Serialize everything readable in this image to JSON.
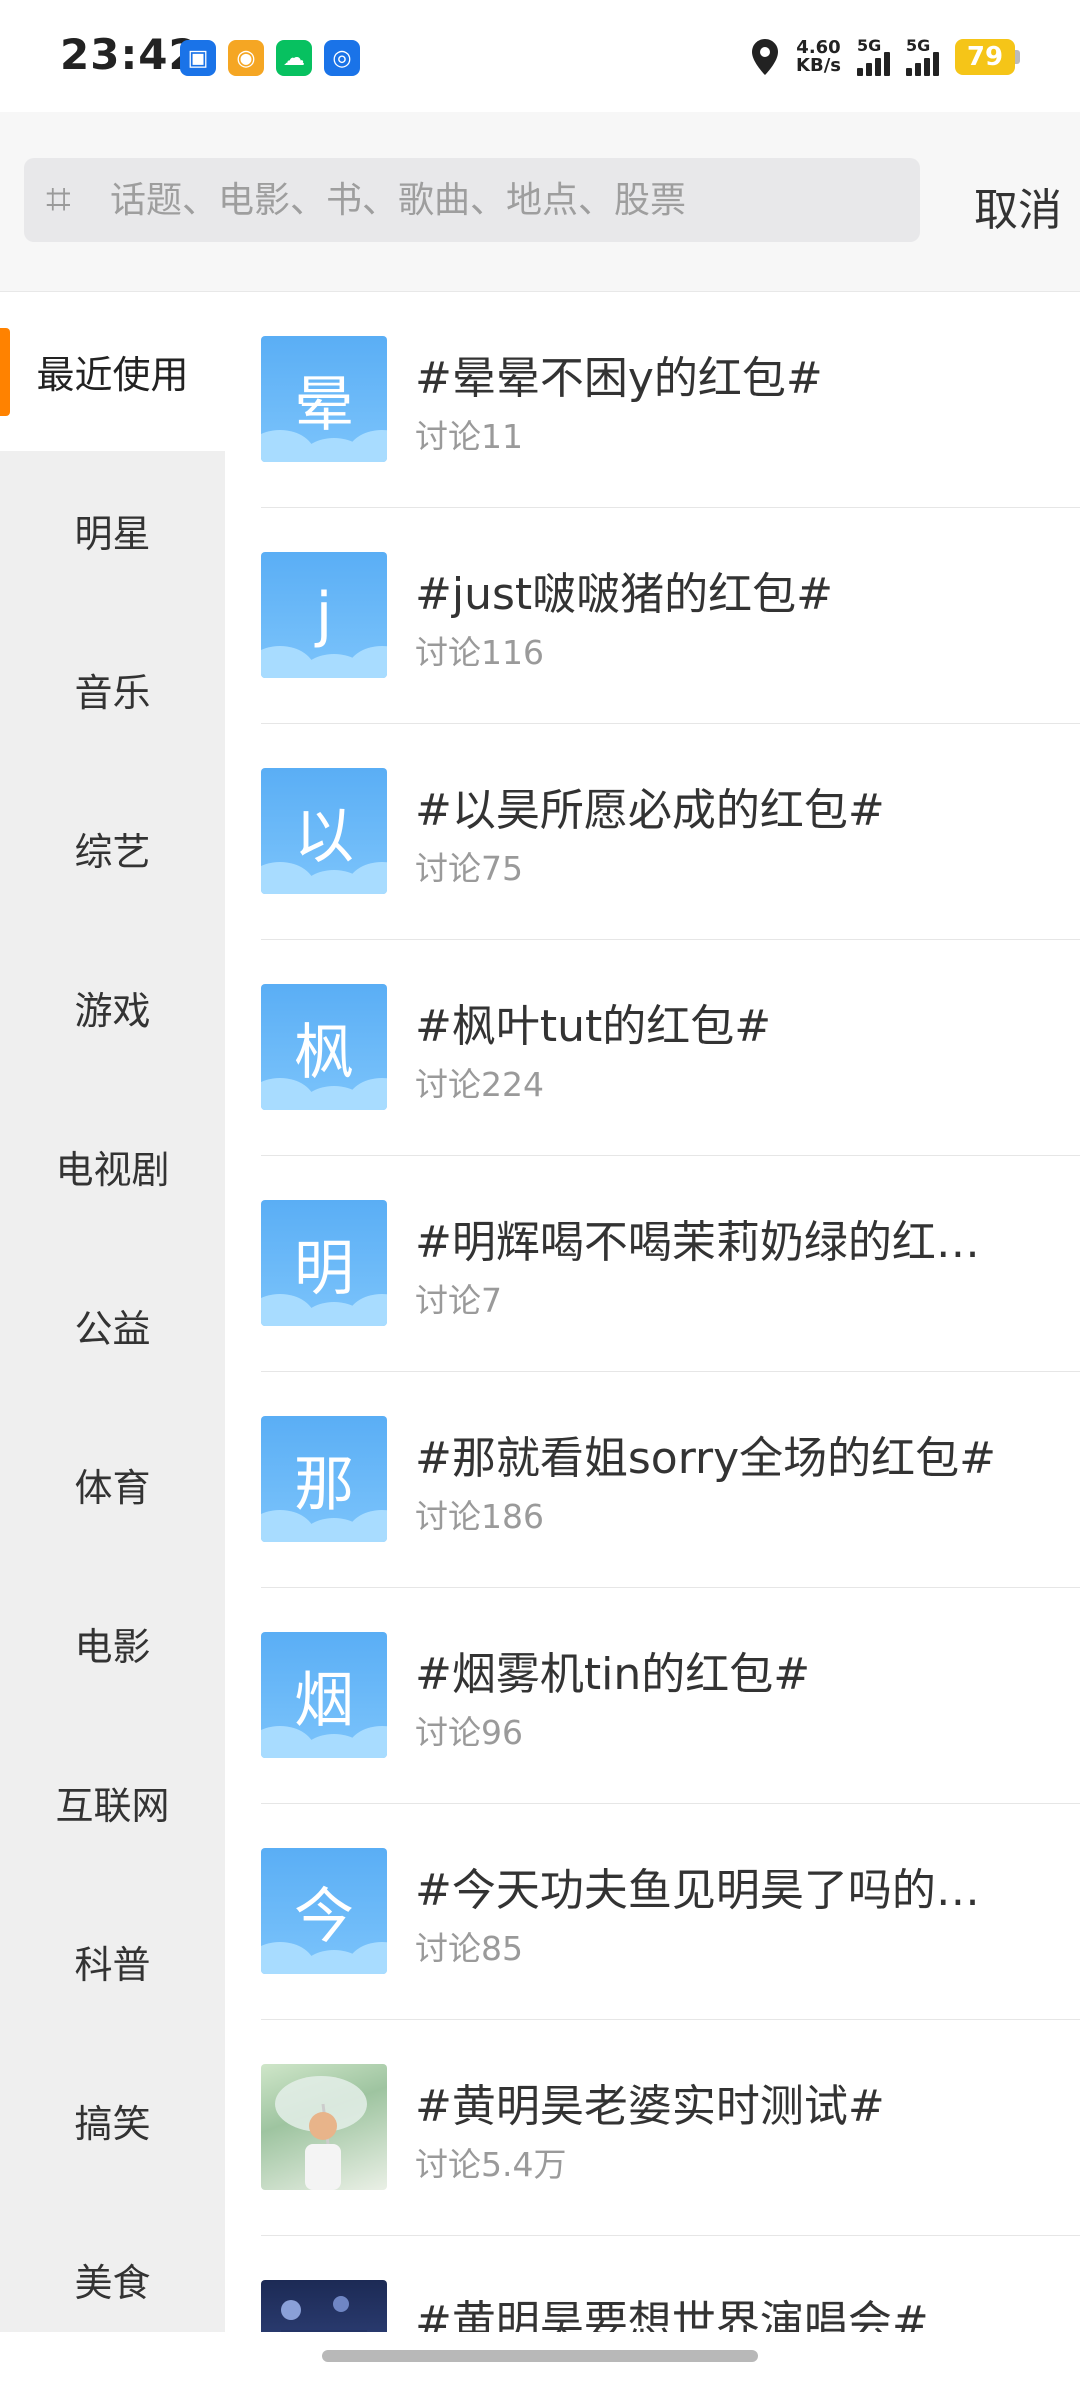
{
  "status_bar": {
    "time": "23:42",
    "net_speed_value": "4.60",
    "net_speed_unit": "KB/s",
    "sim1_gen": "5G",
    "sim2_gen": "5G",
    "battery": "79",
    "app_icons": [
      {
        "name": "tv-icon",
        "color": "#1a73e8"
      },
      {
        "name": "weibo-icon",
        "color": "#f5a623"
      },
      {
        "name": "wechat-icon",
        "color": "#07c160"
      },
      {
        "name": "broadcast-icon",
        "color": "#1a73e8"
      }
    ]
  },
  "search": {
    "placeholder": "话题、电影、书、歌曲、地点、股票",
    "cancel_label": "取消"
  },
  "sidebar": {
    "accent_color": "#ff8200",
    "items": [
      {
        "label": "最近使用",
        "active": true
      },
      {
        "label": "明星"
      },
      {
        "label": "音乐"
      },
      {
        "label": "综艺"
      },
      {
        "label": "游戏"
      },
      {
        "label": "电视剧"
      },
      {
        "label": "公益"
      },
      {
        "label": "体育"
      },
      {
        "label": "电影"
      },
      {
        "label": "互联网"
      },
      {
        "label": "科普"
      },
      {
        "label": "搞笑"
      },
      {
        "label": "美食"
      }
    ]
  },
  "topics": [
    {
      "thumb_char": "晕",
      "title": "#晕晕不困y的红包#",
      "sub": "讨论11"
    },
    {
      "thumb_char": "j",
      "title": "#just啵啵猪的红包#",
      "sub": "讨论116"
    },
    {
      "thumb_char": "以",
      "title": "#以昊所愿必成的红包#",
      "sub": "讨论75"
    },
    {
      "thumb_char": "枫",
      "title": "#枫叶tut的红包#",
      "sub": "讨论224"
    },
    {
      "thumb_char": "明",
      "title": "#明辉喝不喝茉莉奶绿的红…",
      "sub": "讨论7"
    },
    {
      "thumb_char": "那",
      "title": "#那就看姐sorry全场的红包#",
      "sub": "讨论186"
    },
    {
      "thumb_char": "烟",
      "title": "#烟雾机tin的红包#",
      "sub": "讨论96"
    },
    {
      "thumb_char": "今",
      "title": "#今天功夫鱼见明昊了吗的…",
      "sub": "讨论85"
    },
    {
      "thumb_char": "",
      "title": "#黄明昊老婆实时测试#",
      "sub": "讨论5.4万",
      "photo": true
    },
    {
      "thumb_char": "",
      "title": "#黄明昊要想世界演唱会#",
      "sub": "",
      "photo": true
    }
  ]
}
